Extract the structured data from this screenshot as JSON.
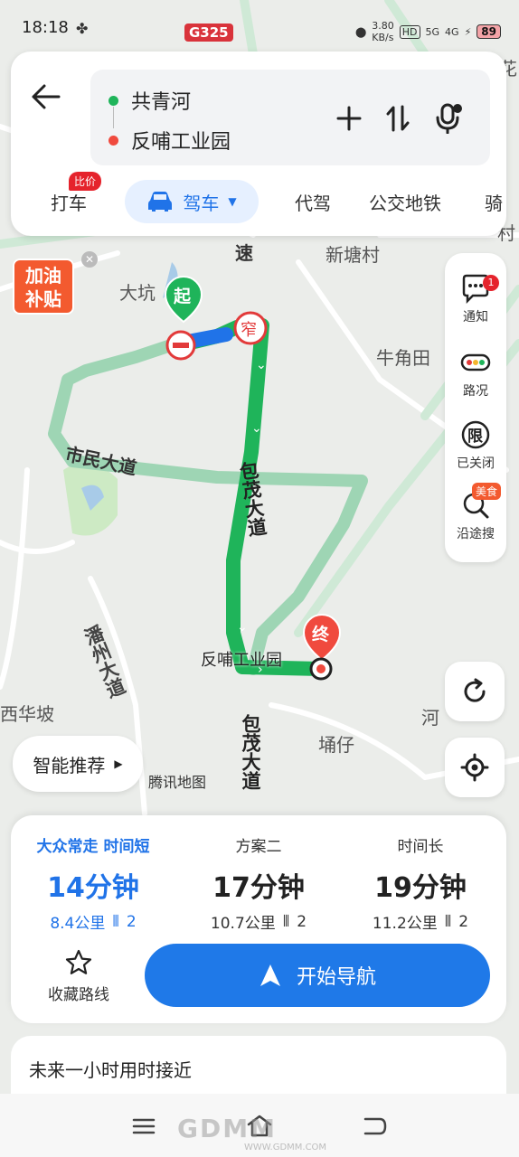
{
  "status_bar": {
    "time": "18:18",
    "road_badge": "G325",
    "net_speed": "3.80",
    "net_unit": "KB/s",
    "hd": "HD",
    "signal_5g": "5G",
    "signal_4g": "4G",
    "battery": "89"
  },
  "route_input": {
    "origin": "共青河",
    "destination": "反哺工业园",
    "origin_color": "#1fb45a",
    "destination_color": "#f04a3e"
  },
  "tabs": [
    {
      "label": "打车",
      "badge": "比价"
    },
    {
      "label": "驾车",
      "active": true
    },
    {
      "label": "代驾"
    },
    {
      "label": "公交地铁"
    },
    {
      "label": "骑"
    }
  ],
  "map": {
    "labels": {
      "xinlincun": "新塘村",
      "dakeng": "大坑",
      "niujiaotian": "牛角田",
      "shimin_road": "市民大道",
      "baomao_road_1": "包茂大道",
      "baomao_road_2": "包茂大道",
      "chaozhou_road": "潘州大道",
      "xihuapo": "西华坡",
      "yongzai": "埇仔",
      "he": "河",
      "su": "速",
      "hua": "花",
      "cun": "村",
      "end_label": "反哺工业园",
      "tencent": "腾讯地图"
    },
    "start_marker": "起",
    "end_marker": "终",
    "narrow_marker": "窄",
    "fuel_promo": [
      "加油",
      "补贴"
    ],
    "route_color": "#1fb45a",
    "alt_route_color": "#9ed5b4"
  },
  "side_tools": [
    {
      "label": "通知",
      "badge": "1"
    },
    {
      "label": "路况"
    },
    {
      "label": "已关闭",
      "icon_text": "限"
    },
    {
      "label": "沿途搜",
      "badge": "美食"
    }
  ],
  "smart_recommend": "智能推荐",
  "plans": [
    {
      "tag": "大众常走 时间短",
      "time": "14分钟",
      "distance": "8.4公里",
      "lights": "2",
      "selected": true
    },
    {
      "tag": "方案二",
      "time": "17分钟",
      "distance": "10.7公里",
      "lights": "2"
    },
    {
      "tag": "时间长",
      "time": "19分钟",
      "distance": "11.2公里",
      "lights": "2"
    }
  ],
  "actions": {
    "favorite": "收藏路线",
    "start_nav": "开始导航"
  },
  "future": "未来一小时用时接近",
  "watermark": {
    "text": "GDMM",
    "url": "WWW.GDMM.COM"
  }
}
